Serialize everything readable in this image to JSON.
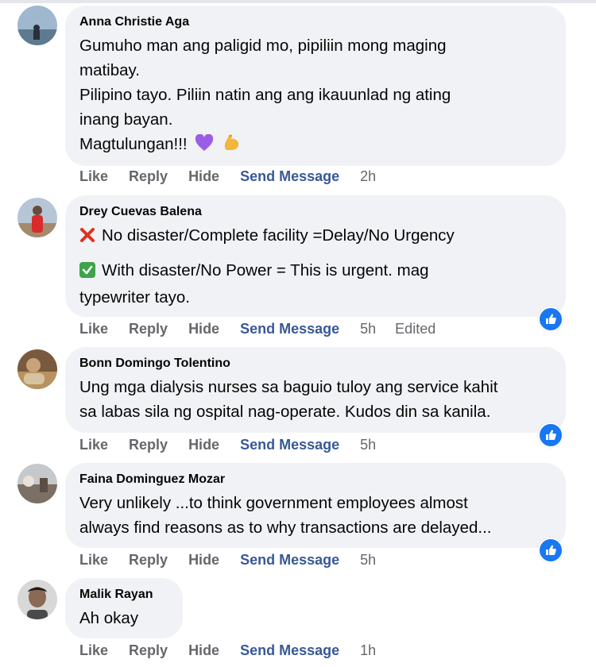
{
  "comments": [
    {
      "author": "Anna Christie Aga",
      "lines": [
        "Gumuho man ang paligid mo, pipiliin mong maging",
        "matibay.",
        "Pilipino tayo. Piliin natin ang ang ikauunlad ng ating",
        "inang bayan.",
        "Magtulungan!!!"
      ],
      "emoji_tail": [
        "purple-heart-icon",
        "flexed-biceps-icon"
      ],
      "actions": {
        "like": "Like",
        "reply": "Reply",
        "hide": "Hide",
        "send": "Send Message",
        "time": "2h"
      }
    },
    {
      "author": "Drey Cuevas Balena",
      "lines": [
        "No disaster/Complete facility =Delay/No Urgency",
        "With disaster/No Power = This is urgent. mag",
        "typewriter tayo."
      ],
      "line_icons": [
        "cross-mark-icon",
        "check-mark-icon"
      ],
      "actions": {
        "like": "Like",
        "reply": "Reply",
        "hide": "Hide",
        "send": "Send Message",
        "time": "5h",
        "edited": "Edited"
      },
      "reaction": "like-reaction-icon"
    },
    {
      "author": "Bonn Domingo Tolentino",
      "lines": [
        "Ung mga dialysis nurses sa baguio tuloy ang service kahit",
        "sa labas sila ng ospital nag-operate. Kudos din sa kanila."
      ],
      "actions": {
        "like": "Like",
        "reply": "Reply",
        "hide": "Hide",
        "send": "Send Message",
        "time": "5h"
      },
      "reaction": "like-reaction-icon"
    },
    {
      "author": "Faina Dominguez Mozar",
      "lines": [
        "Very unlikely ...to think government employees almost",
        "always find reasons as to why transactions are delayed..."
      ],
      "actions": {
        "like": "Like",
        "reply": "Reply",
        "hide": "Hide",
        "send": "Send Message",
        "time": "5h"
      },
      "reaction": "like-reaction-icon"
    },
    {
      "author": "Malik Rayan",
      "lines": [
        "Ah okay"
      ],
      "actions": {
        "like": "Like",
        "reply": "Reply",
        "hide": "Hide",
        "send": "Send Message",
        "time": "1h"
      }
    }
  ],
  "colors": {
    "bubble": "#f0f2f5",
    "link": "#385898",
    "muted": "#65676b",
    "reaction": "#1877f2"
  }
}
